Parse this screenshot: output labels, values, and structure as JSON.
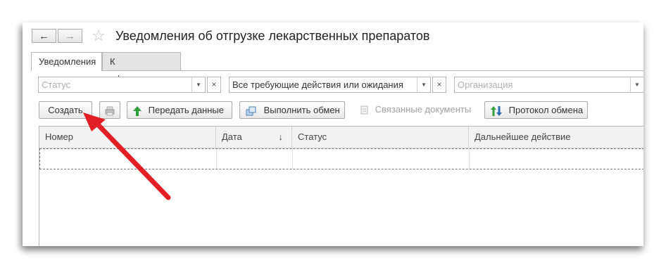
{
  "window": {
    "title": "Уведомления об отгрузке лекарственных препаратов",
    "nav": {
      "back_icon": "←",
      "forward_icon": "→",
      "star_icon": "☆"
    }
  },
  "tabs": [
    {
      "label": "Уведомления",
      "active": true
    },
    {
      "label": "К оформлению",
      "active": false
    }
  ],
  "filters": {
    "status": {
      "placeholder": "Статус",
      "value": ""
    },
    "action": {
      "value": "Все требующие действия или ожидания"
    },
    "organization": {
      "placeholder": "Организация",
      "value": ""
    },
    "drop_icon": "▼",
    "clear_icon": "×"
  },
  "toolbar": {
    "create_label": "Создать",
    "send_label": "Передать данные",
    "exchange_label": "Выполнить обмен",
    "related_label": "Связанные документы",
    "protocol_label": "Протокол обмена"
  },
  "table": {
    "columns": [
      "Номер",
      "Дата",
      "Статус",
      "Дальнейшее действие"
    ],
    "sort_icon": "↓",
    "rows": []
  },
  "colors": {
    "accent_arrow": "#e31e24",
    "header_bg": "#f2f2f2",
    "border": "#b6b6b6"
  }
}
